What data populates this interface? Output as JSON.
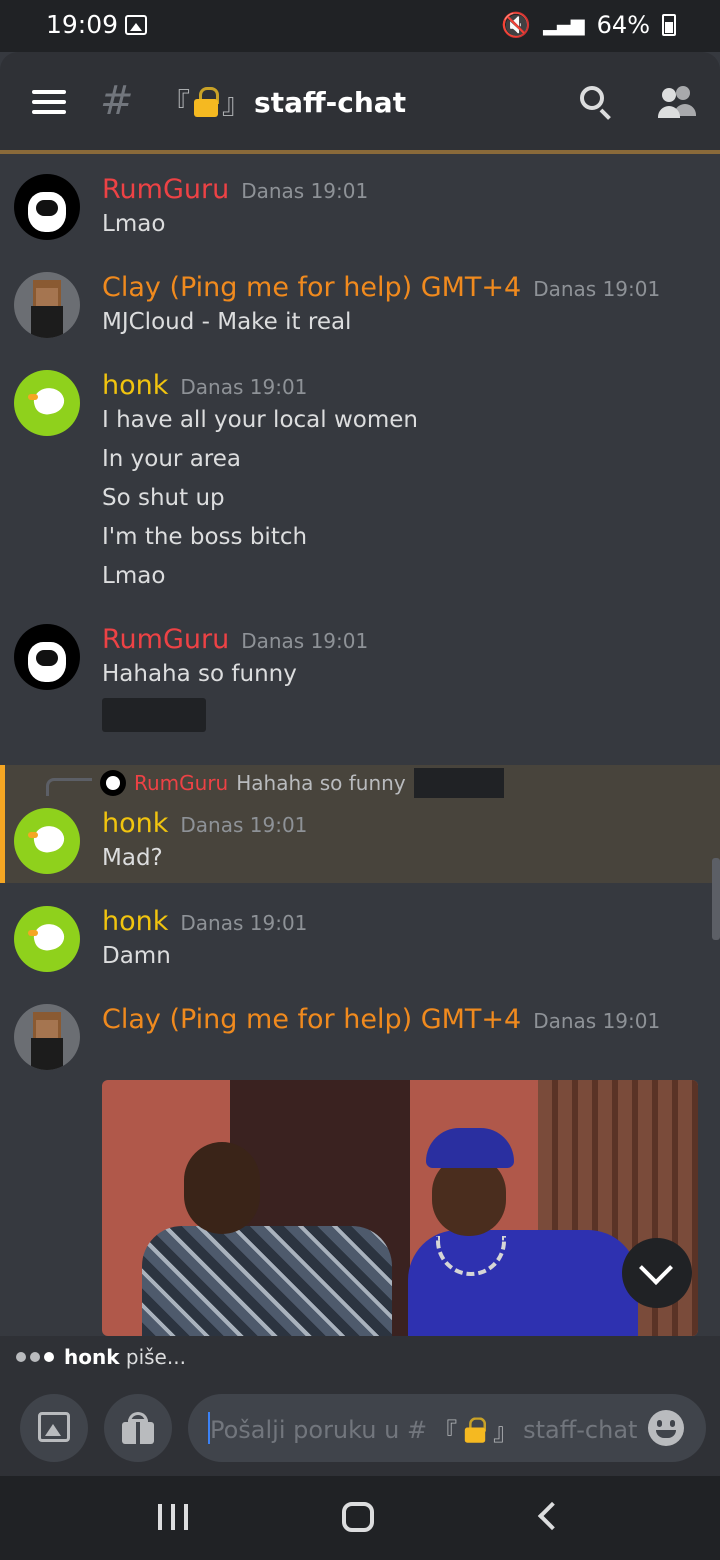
{
  "status_bar": {
    "time": "19:09",
    "battery": "64%"
  },
  "header": {
    "channel_name": "staff-chat",
    "bracket_open": "『",
    "bracket_close": "』"
  },
  "messages": [
    {
      "author": "RumGuru",
      "time": "Danas 19:01",
      "lines": [
        "Lmao"
      ]
    },
    {
      "author": "Clay (Ping me for help) GMT+4",
      "time": "Danas 19:01",
      "lines": [
        "MJCloud - Make it real"
      ]
    },
    {
      "author": "honk",
      "time": "Danas 19:01",
      "lines": [
        "I have all your local women",
        "In your area",
        "So shut up",
        "I'm the boss bitch",
        "Lmao"
      ]
    },
    {
      "author": "RumGuru",
      "time": "Danas 19:01",
      "lines": [
        "Hahaha so funny"
      ]
    },
    {
      "author": "honk",
      "time": "Danas 19:01",
      "lines": [
        "Mad?"
      ],
      "reply_to": {
        "author": "RumGuru",
        "text": "Hahaha so funny"
      }
    },
    {
      "author": "honk",
      "time": "Danas 19:01",
      "lines": [
        "Damn"
      ]
    },
    {
      "author": "Clay (Ping me for help) GMT+4",
      "time": "Danas 19:01",
      "lines": []
    }
  ],
  "typing": {
    "user": "honk",
    "suffix": " piše..."
  },
  "composer": {
    "placeholder_prefix": "Pošalji poruku u #",
    "channel": "staff-chat"
  },
  "colors": {
    "rumguru": "#ed4245",
    "clay": "#f08a1e",
    "honk": "#f1c40f",
    "reply_accent": "#f5a623"
  },
  "icons": [
    "menu-icon",
    "hash-icon",
    "lock-icon",
    "search-icon",
    "members-icon",
    "image-icon",
    "gift-icon",
    "emoji-icon",
    "chevron-down-icon"
  ]
}
